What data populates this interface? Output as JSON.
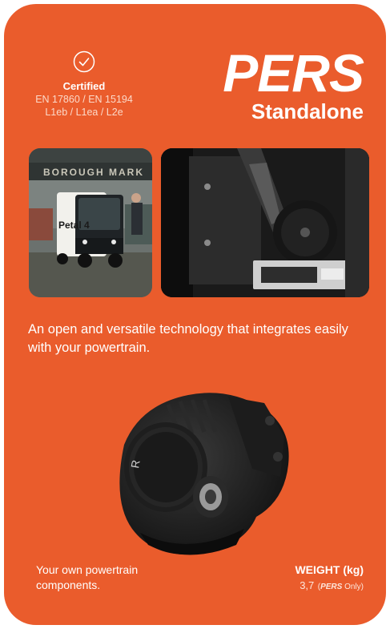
{
  "certification": {
    "icon": "check-circle-icon",
    "title": "Certified",
    "standards": "EN 17860 / EN 15194",
    "classes": "L1eb / L1ea / L2e"
  },
  "headline": {
    "brand": "PERS",
    "subtitle": "Standalone"
  },
  "photos": {
    "left_sign": "BOROUGH MARK",
    "left_van_label": "Petal 4"
  },
  "intro": "An open and versatile technology that integrates easily with your powertrain.",
  "footer": {
    "components": "Your own powertrain components.",
    "weight_label": "WEIGHT (kg)",
    "weight_value": "3,7",
    "weight_brand": "PERS",
    "weight_suffix": "Only"
  },
  "colors": {
    "card": "#ea5c2c",
    "text": "#ffffff"
  }
}
